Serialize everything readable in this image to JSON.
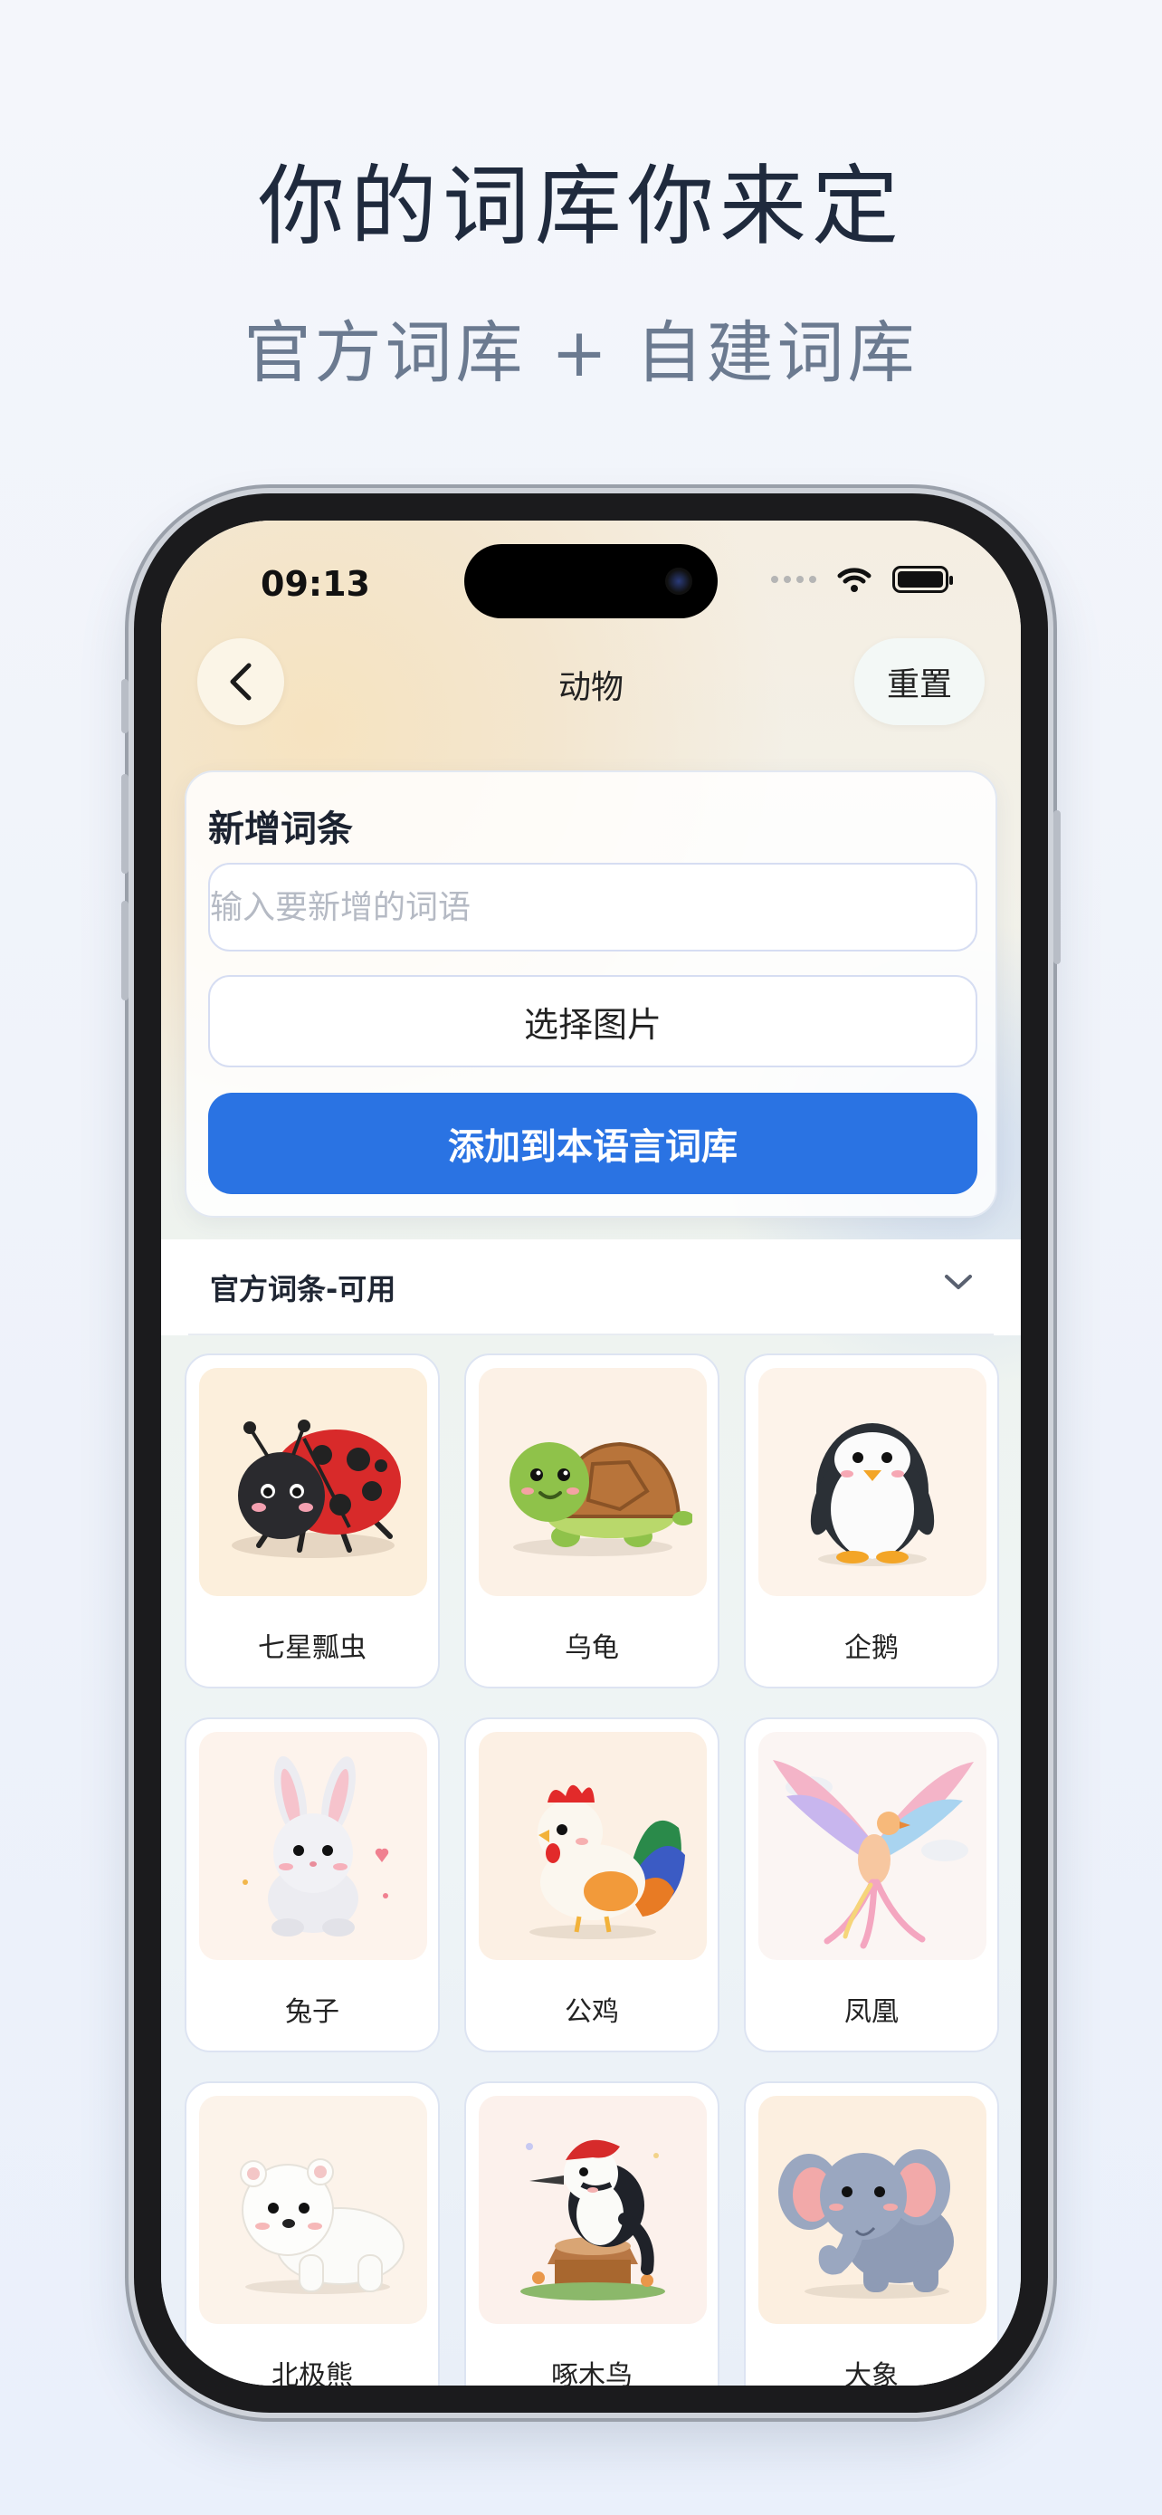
{
  "promo": {
    "headline": "你的词库你来定",
    "subheadline": "官方词库 + 自建词库"
  },
  "status_bar": {
    "time": "09:13"
  },
  "nav": {
    "title": "动物",
    "reset_label": "重置"
  },
  "add_card": {
    "title": "新增词条",
    "input_placeholder": "输入要新增的词语",
    "input_value": "",
    "pick_image_label": "选择图片",
    "add_button_label": "添加到本语言词库"
  },
  "section": {
    "label": "官方词条-可用"
  },
  "words": [
    {
      "name": "七星瓢虫",
      "icon": "ladybug-icon"
    },
    {
      "name": "乌龟",
      "icon": "turtle-icon"
    },
    {
      "name": "企鹅",
      "icon": "penguin-icon"
    },
    {
      "name": "兔子",
      "icon": "rabbit-icon"
    },
    {
      "name": "公鸡",
      "icon": "rooster-icon"
    },
    {
      "name": "凤凰",
      "icon": "phoenix-icon"
    },
    {
      "name": "北极熊",
      "icon": "polar-bear-icon"
    },
    {
      "name": "啄木鸟",
      "icon": "woodpecker-icon"
    },
    {
      "name": "大象",
      "icon": "elephant-icon"
    }
  ],
  "colors": {
    "accent": "#2a73e3",
    "headline": "#1f2a3d",
    "subheadline": "#6b7a90"
  }
}
